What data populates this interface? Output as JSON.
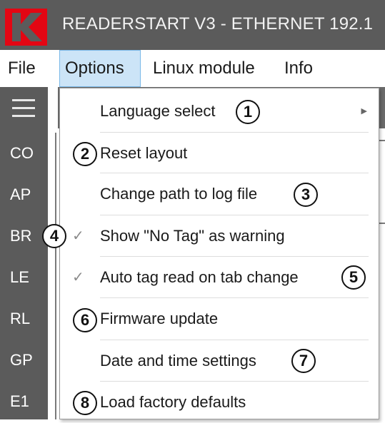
{
  "app": {
    "title": "READERSTART V3 - ETHERNET 192.1",
    "logo_icon": "k-logo-icon",
    "logo_color": "#e30613"
  },
  "menubar": {
    "items": [
      {
        "label": "File"
      },
      {
        "label": "Options",
        "active": true
      },
      {
        "label": "Linux module"
      },
      {
        "label": "Info"
      }
    ]
  },
  "sidebar": {
    "menu_icon": "hamburger-icon",
    "items": [
      {
        "label": "CO"
      },
      {
        "label": "AP"
      },
      {
        "label": "BR"
      },
      {
        "label": "LE"
      },
      {
        "label": "RL"
      },
      {
        "label": "GP"
      },
      {
        "label": "E1"
      }
    ]
  },
  "options_menu": {
    "items": [
      {
        "label": "Language select",
        "callout": "1",
        "has_submenu": true,
        "submenu_icon": "chevron-right-icon"
      },
      {
        "label": "Reset layout",
        "callout": "2"
      },
      {
        "label": "Change path to log file",
        "callout": "3"
      },
      {
        "label": "Show \"No Tag\" as warning",
        "callout": "4",
        "checked": true,
        "check_icon": "checkmark-icon"
      },
      {
        "label": "Auto tag read on tab change",
        "callout": "5",
        "checked": true,
        "check_icon": "checkmark-icon"
      },
      {
        "label": "Firmware update",
        "callout": "6"
      },
      {
        "label": "Date and time settings",
        "callout": "7"
      },
      {
        "label": "Load factory defaults",
        "callout": "8"
      }
    ]
  },
  "colors": {
    "titlebar": "#5b5b5b",
    "sidebar": "#5b5b5b",
    "menu_active_bg": "#cce4f7"
  }
}
